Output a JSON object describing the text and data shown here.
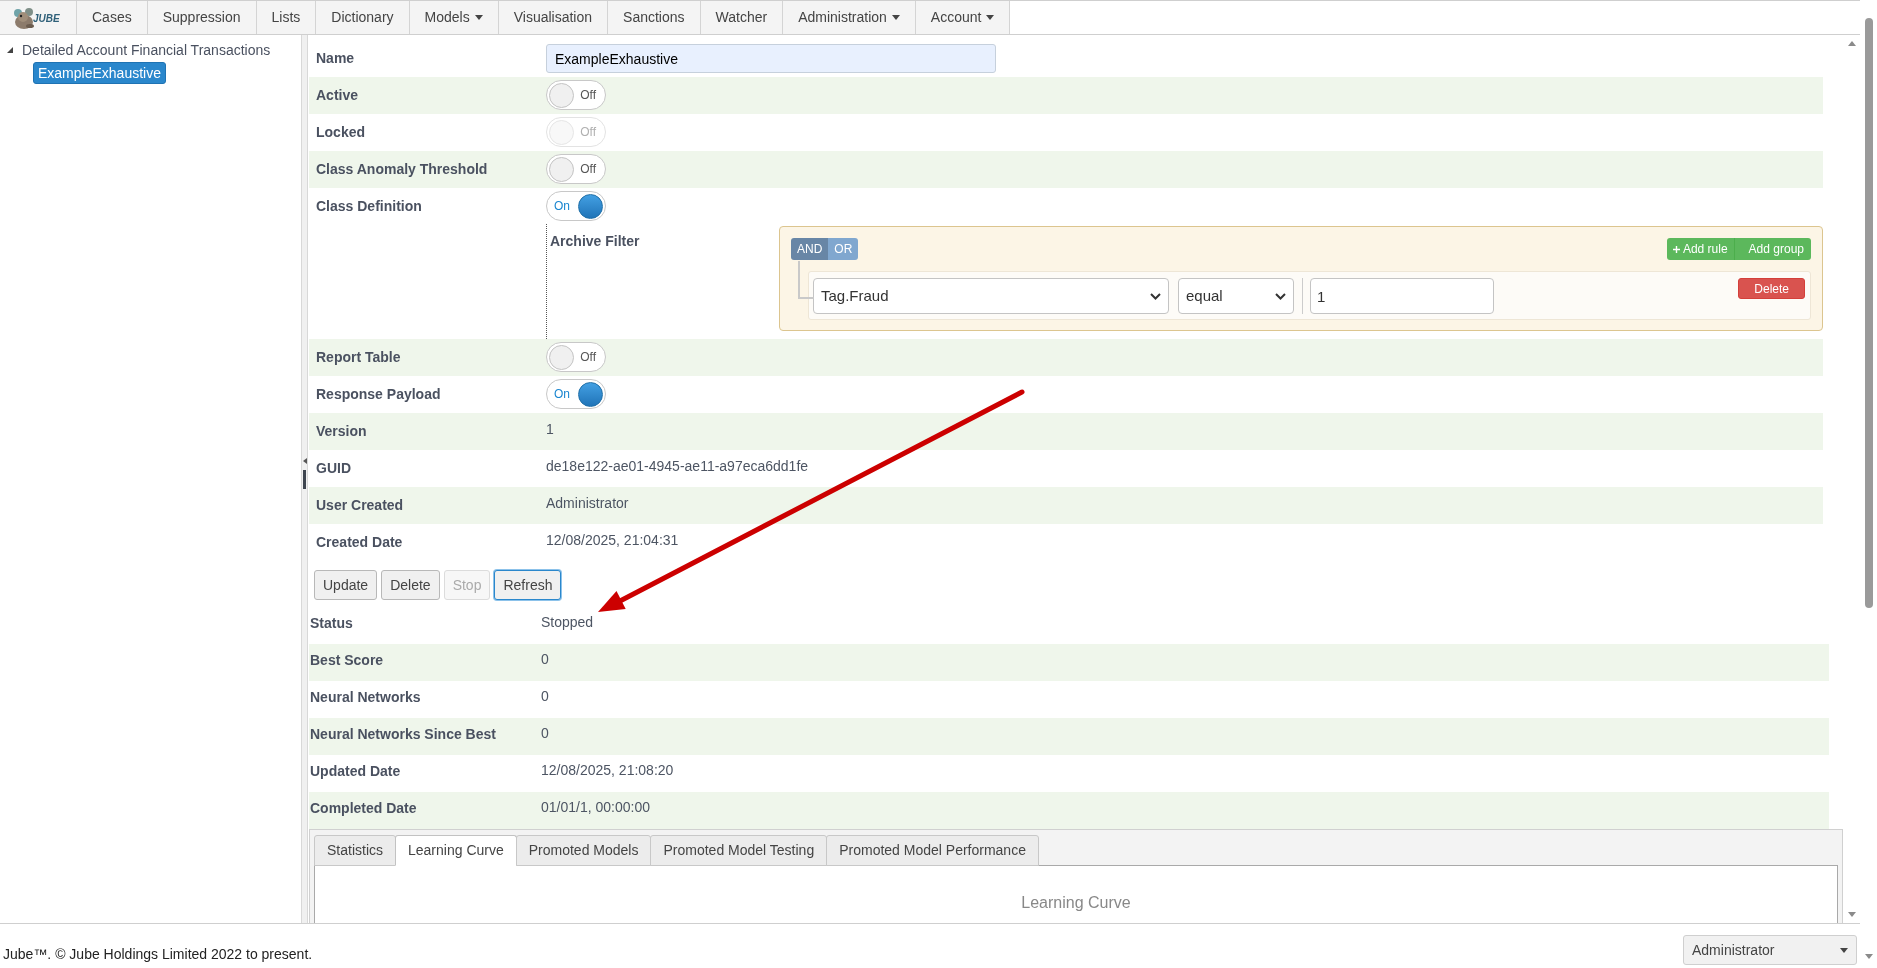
{
  "nav": {
    "logo_text": "JUBE",
    "items": [
      {
        "label": "Cases",
        "dropdown": false
      },
      {
        "label": "Suppression",
        "dropdown": false
      },
      {
        "label": "Lists",
        "dropdown": false
      },
      {
        "label": "Dictionary",
        "dropdown": false
      },
      {
        "label": "Models",
        "dropdown": true
      },
      {
        "label": "Visualisation",
        "dropdown": false
      },
      {
        "label": "Sanctions",
        "dropdown": false
      },
      {
        "label": "Watcher",
        "dropdown": false
      },
      {
        "label": "Administration",
        "dropdown": true
      },
      {
        "label": "Account",
        "dropdown": true
      }
    ]
  },
  "tree": [
    {
      "label": "Detailed Account Financial Transactions",
      "expanded": true,
      "selected": false,
      "children": [
        {
          "label": "ExampleExhaustive",
          "selected": true
        }
      ]
    }
  ],
  "form": {
    "fields": [
      {
        "kind": "input",
        "label": "Name",
        "value": "ExampleExhaustive"
      },
      {
        "kind": "toggle",
        "label": "Active",
        "on": false,
        "disabled": false,
        "state_label": "Off"
      },
      {
        "kind": "toggle",
        "label": "Locked",
        "on": false,
        "disabled": true,
        "state_label": "Off"
      },
      {
        "kind": "toggle",
        "label": "Class Anomaly Threshold",
        "on": false,
        "disabled": false,
        "state_label": "Off"
      },
      {
        "kind": "toggle",
        "label": "Class Definition",
        "on": true,
        "disabled": false,
        "state_label": "On",
        "filter": {
          "label": "Archive Filter",
          "conditions": [
            {
              "label": "AND",
              "selected": true
            },
            {
              "label": "OR",
              "selected": false
            }
          ],
          "add_rule": "Add rule",
          "add_group": "Add group",
          "rules": [
            {
              "field": "Tag.Fraud",
              "operator": "equal",
              "value": "1",
              "delete": "Delete"
            }
          ]
        }
      },
      {
        "kind": "toggle",
        "label": "Report Table",
        "on": false,
        "disabled": false,
        "state_label": "Off"
      },
      {
        "kind": "toggle",
        "label": "Response Payload",
        "on": true,
        "disabled": false,
        "state_label": "On"
      },
      {
        "kind": "text",
        "label": "Version",
        "value": "1"
      },
      {
        "kind": "text",
        "label": "GUID",
        "value": "de18e122-ae01-4945-ae11-a97eca6dd1fe"
      },
      {
        "kind": "text",
        "label": "User Created",
        "value": "Administrator"
      },
      {
        "kind": "text",
        "label": "Created Date",
        "value": "12/08/2025, 21:04:31"
      }
    ]
  },
  "buttons": [
    {
      "label": "Update",
      "disabled": false,
      "focused": false
    },
    {
      "label": "Delete",
      "disabled": false,
      "focused": false
    },
    {
      "label": "Stop",
      "disabled": true,
      "focused": false
    },
    {
      "label": "Refresh",
      "disabled": false,
      "focused": true
    }
  ],
  "status": [
    {
      "label": "Status",
      "value": "Stopped"
    },
    {
      "label": "Best Score",
      "value": "0"
    },
    {
      "label": "Neural Networks",
      "value": "0"
    },
    {
      "label": "Neural Networks Since Best",
      "value": "0"
    },
    {
      "label": "Updated Date",
      "value": "12/08/2025, 21:08:20"
    },
    {
      "label": "Completed Date",
      "value": "01/01/1, 00:00:00"
    }
  ],
  "tabs": [
    {
      "label": "Statistics",
      "selected": false
    },
    {
      "label": "Learning Curve",
      "selected": true
    },
    {
      "label": "Promoted Models",
      "selected": false
    },
    {
      "label": "Promoted Model Testing",
      "selected": false
    },
    {
      "label": "Promoted Model Performance",
      "selected": false
    }
  ],
  "tab_panel": {
    "title": "Learning Curve"
  },
  "footer": {
    "text": "Jube™. © Jube Holdings Limited 2022 to present.",
    "user": "Administrator"
  }
}
